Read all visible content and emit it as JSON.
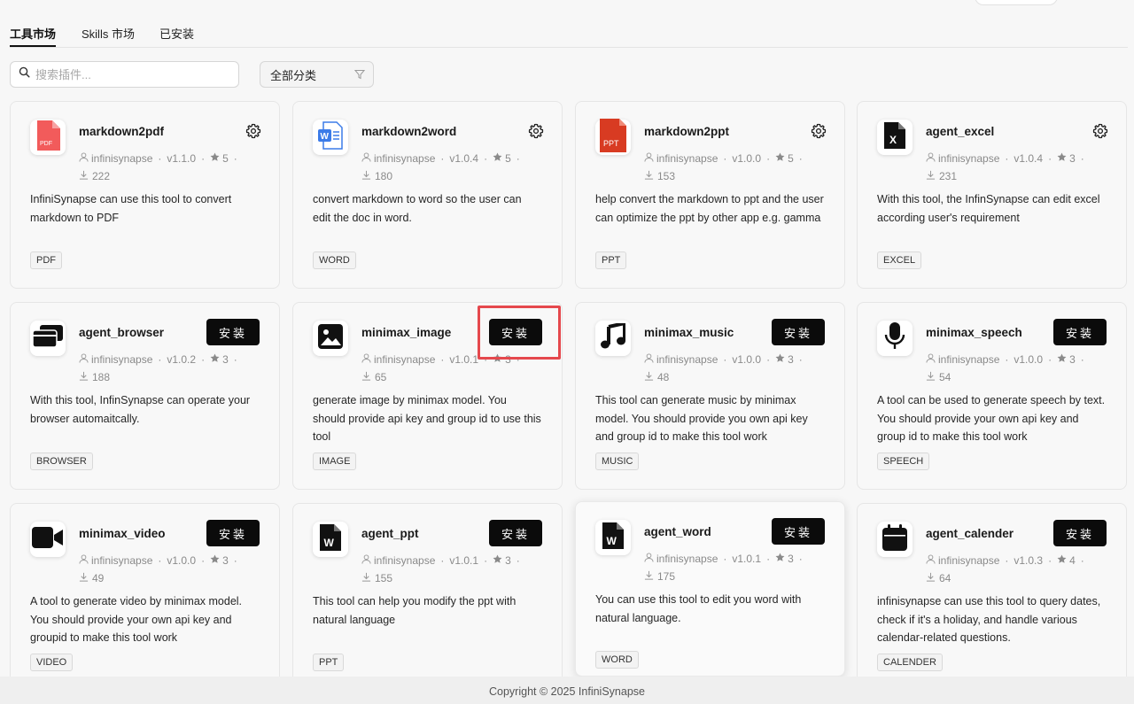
{
  "tabs": [
    {
      "label": "工具市场",
      "active": true
    },
    {
      "label": "Skills 市场",
      "active": false
    },
    {
      "label": "已安装",
      "active": false
    }
  ],
  "search": {
    "placeholder": "搜索插件..."
  },
  "category": {
    "selected": "全部分类"
  },
  "install_label": "安装",
  "cards": [
    {
      "name": "markdown2pdf",
      "author": "infinisynapse",
      "version": "v1.1.0",
      "stars": "5",
      "downloads": "222",
      "description": "InfiniSynapse can use this tool to convert markdown to PDF",
      "tag": "PDF",
      "icon": "pdf-file-icon",
      "action": "settings"
    },
    {
      "name": "markdown2word",
      "author": "infinisynapse",
      "version": "v1.0.4",
      "stars": "5",
      "downloads": "180",
      "description": "convert markdown to word so the user can edit the doc in word.",
      "tag": "WORD",
      "icon": "word-file-icon",
      "action": "settings"
    },
    {
      "name": "markdown2ppt",
      "author": "infinisynapse",
      "version": "v1.0.0",
      "stars": "5",
      "downloads": "153",
      "description": "help convert the markdown to ppt and the user can optimize the ppt by other app e.g. gamma",
      "tag": "PPT",
      "icon": "ppt-file-icon",
      "action": "settings"
    },
    {
      "name": "agent_excel",
      "author": "infinisynapse",
      "version": "v1.0.4",
      "stars": "3",
      "downloads": "231",
      "description": "With this tool, the InfinSynapse can edit excel according user's requirement",
      "tag": "EXCEL",
      "icon": "excel-file-icon",
      "action": "settings"
    },
    {
      "name": "agent_browser",
      "author": "infinisynapse",
      "version": "v1.0.2",
      "stars": "3",
      "downloads": "188",
      "description": "With this tool, InfinSynapse can operate your browser automaitcally.",
      "tag": "BROWSER",
      "icon": "browser-windows-icon",
      "action": "install"
    },
    {
      "name": "minimax_image",
      "author": "infinisynapse",
      "version": "v1.0.1",
      "stars": "3",
      "downloads": "65",
      "description": "generate image by minimax model. You should provide api key and group id to use this tool",
      "tag": "IMAGE",
      "icon": "image-icon",
      "action": "install"
    },
    {
      "name": "minimax_music",
      "author": "infinisynapse",
      "version": "v1.0.0",
      "stars": "3",
      "downloads": "48",
      "description": "This tool can generate music by minimax model. You should provide you own api key and group id to make this tool work",
      "tag": "MUSIC",
      "icon": "music-note-icon",
      "action": "install"
    },
    {
      "name": "minimax_speech",
      "author": "infinisynapse",
      "version": "v1.0.0",
      "stars": "3",
      "downloads": "54",
      "description": "A tool can be used to generate speech by text. You should provide your own api key and group id to make this tool work",
      "tag": "SPEECH",
      "icon": "microphone-icon",
      "action": "install"
    },
    {
      "name": "minimax_video",
      "author": "infinisynapse",
      "version": "v1.0.0",
      "stars": "3",
      "downloads": "49",
      "description": "A tool to generate video by minimax model. You should provide your own api key and groupid to make this tool work",
      "tag": "VIDEO",
      "icon": "video-camera-icon",
      "action": "install"
    },
    {
      "name": "agent_ppt",
      "author": "infinisynapse",
      "version": "v1.0.1",
      "stars": "3",
      "downloads": "155",
      "description": "This tool can help you modify the ppt with natural language",
      "tag": "PPT",
      "icon": "word-doc-icon",
      "action": "install"
    },
    {
      "name": "agent_word",
      "author": "infinisynapse",
      "version": "v1.0.1",
      "stars": "3",
      "downloads": "175",
      "description": "You can use this tool to edit you word with natural language.",
      "tag": "WORD",
      "icon": "word-doc-icon",
      "action": "install"
    },
    {
      "name": "agent_calender",
      "author": "infinisynapse",
      "version": "v1.0.3",
      "stars": "4",
      "downloads": "64",
      "description": "infinisynapse can use this tool to query dates, check if it's a holiday, and handle various calendar-related questions.",
      "tag": "CALENDER",
      "icon": "calendar-icon",
      "action": "install"
    }
  ],
  "footer": {
    "text": "Copyright © 2025 InfiniSynapse"
  },
  "colors": {
    "accent": "#0b0b0b",
    "highlight": "#e5484d",
    "pdf": "#f25b5b",
    "word": "#3b7be8",
    "ppt": "#d83b22"
  }
}
